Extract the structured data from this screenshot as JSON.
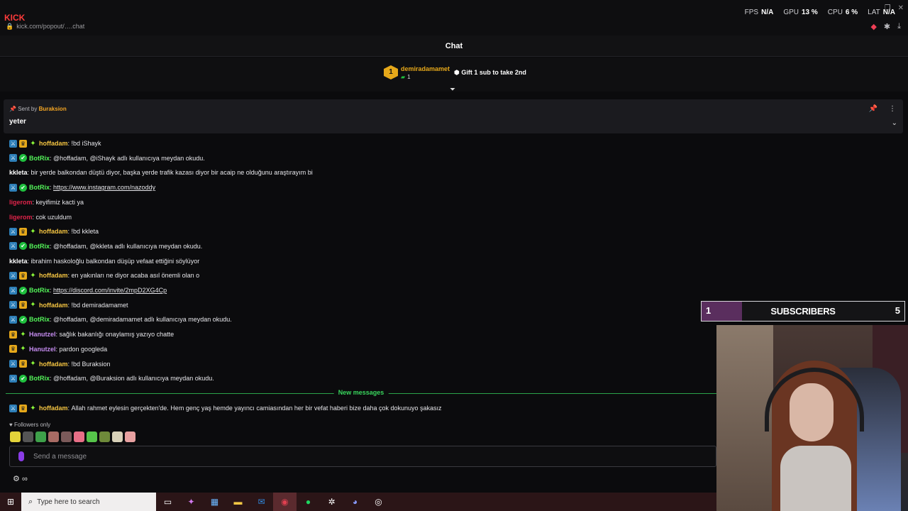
{
  "browser": {
    "url": "kick.com/popout/….chat",
    "logo": "KICK"
  },
  "stats": [
    {
      "label": "FPS",
      "value": "N/A"
    },
    {
      "label": "GPU",
      "value": "13 %"
    },
    {
      "label": "CPU",
      "value": "6 %"
    },
    {
      "label": "LAT",
      "value": "N/A"
    }
  ],
  "chat": {
    "title": "Chat",
    "leader": {
      "rank": "1",
      "name": "demiradamamet",
      "count": "1",
      "gift": "Gift 1 sub to take 2nd"
    },
    "pinned": {
      "sent_prefix": "Sent by",
      "sender": "Buraksion",
      "message": "yeter"
    },
    "messages": [
      {
        "badges": [
          "mod",
          "vip",
          "star"
        ],
        "user": "hoffadam",
        "color": "#f5c542",
        "text": "!bd iShayk"
      },
      {
        "badges": [
          "mod",
          "bot"
        ],
        "user": "BotRix",
        "color": "#54f55a",
        "text": "@hoffadam, @iShayk adlı kullanıcıya meydan okudu."
      },
      {
        "badges": [],
        "user": "kkleta",
        "color": "#ffffff",
        "text": "bir yerde balkondan düştü diyor, başka yerde trafik kazası diyor bir acaip ne olduğunu araştırayım bi"
      },
      {
        "badges": [
          "mod",
          "bot"
        ],
        "user": "BotRix",
        "color": "#54f55a",
        "text": "https://www.instagram.com/nazoddy",
        "link": true
      },
      {
        "badges": [],
        "user": "ligerom",
        "color": "#e0244a",
        "text": "keyifimiz kacti ya"
      },
      {
        "badges": [],
        "user": "ligerom",
        "color": "#e0244a",
        "text": "cok uzuldum"
      },
      {
        "badges": [
          "mod",
          "vip",
          "star"
        ],
        "user": "hoffadam",
        "color": "#f5c542",
        "text": "!bd kkleta"
      },
      {
        "badges": [
          "mod",
          "bot"
        ],
        "user": "BotRix",
        "color": "#54f55a",
        "text": "@hoffadam, @kkleta adlı kullanıcıya meydan okudu."
      },
      {
        "badges": [],
        "user": "kkleta",
        "color": "#ffffff",
        "text": "ibrahim haskoloğlu balkondan düşüp vefaat ettiğini söylüyor"
      },
      {
        "badges": [
          "mod",
          "vip",
          "star"
        ],
        "user": "hoffadam",
        "color": "#f5c542",
        "text": "en yakınları ne diyor acaba asıl önemli olan o"
      },
      {
        "badges": [
          "mod",
          "bot"
        ],
        "user": "BotRix",
        "color": "#54f55a",
        "text": "https://discord.com/invite/2mpD2XG4Cp",
        "link": true
      },
      {
        "badges": [
          "mod",
          "vip",
          "star"
        ],
        "user": "hoffadam",
        "color": "#f5c542",
        "text": "!bd demiradamamet"
      },
      {
        "badges": [
          "mod",
          "bot"
        ],
        "user": "BotRix",
        "color": "#54f55a",
        "text": "@hoffadam, @demiradamamet adlı kullanıcıya meydan okudu."
      },
      {
        "badges": [
          "vip",
          "star"
        ],
        "user": "Hanutzel",
        "color": "#c58cf0",
        "text": "sağlık bakanlığı onaylamış yazıyo chatte"
      },
      {
        "badges": [
          "vip",
          "star"
        ],
        "user": "Hanutzel",
        "color": "#c58cf0",
        "text": "pardon googleda"
      },
      {
        "badges": [
          "mod",
          "vip",
          "star"
        ],
        "user": "hoffadam",
        "color": "#f5c542",
        "text": "!bd Buraksion"
      },
      {
        "badges": [
          "mod",
          "bot"
        ],
        "user": "BotRix",
        "color": "#54f55a",
        "text": "@hoffadam, @Buraksion adlı kullanıcıya meydan okudu."
      }
    ],
    "new_messages_label": "New messages",
    "after_new": {
      "badges": [
        "mod",
        "vip",
        "star"
      ],
      "user": "hoffadam",
      "color": "#f5c542",
      "text": "Allah rahmet eylesin gerçekten'de. Hem genç yaş hemde yayıncı camiasından her bir vefat haberi bize daha çok dokunuyo şakasız"
    },
    "followers_only": "Followers only",
    "input_placeholder": "Send a message",
    "controls": "∞"
  },
  "subscribers": {
    "current": "1",
    "label": "SUBSCRIBERS",
    "goal": "5",
    "fraction": 0.2
  },
  "taskbar": {
    "search_placeholder": "Type here to search",
    "apps": [
      "task-view",
      "copilot",
      "store",
      "file-explorer",
      "outlook",
      "browser",
      "spotify",
      "app-gear",
      "discord",
      "obs"
    ]
  },
  "colors": {
    "accent_green": "#53fc18",
    "new_messages": "#39d65d",
    "subs_fill": "#5a2e5e"
  }
}
